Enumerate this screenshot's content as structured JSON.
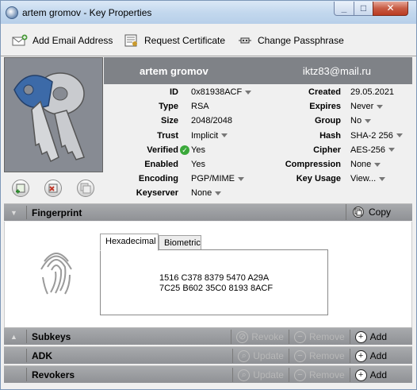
{
  "window": {
    "title": "artem gromov - Key Properties"
  },
  "toolbar": {
    "add_email": "Add Email Address",
    "request_cert": "Request Certificate",
    "change_pass": "Change Passphrase"
  },
  "header": {
    "name": "artem gromov",
    "email": "iktz83@mail.ru"
  },
  "props_left": [
    {
      "label": "ID",
      "value": "0x81938ACF",
      "dropdown": true
    },
    {
      "label": "Type",
      "value": "RSA",
      "dropdown": false
    },
    {
      "label": "Size",
      "value": "2048/2048",
      "dropdown": false
    },
    {
      "label": "Trust",
      "value": "Implicit",
      "dropdown": true
    },
    {
      "label": "Verified",
      "value": "Yes",
      "dropdown": false
    },
    {
      "label": "Enabled",
      "value": "Yes",
      "dropdown": false
    },
    {
      "label": "Encoding",
      "value": "PGP/MIME",
      "dropdown": true
    },
    {
      "label": "Keyserver",
      "value": "None",
      "dropdown": true
    }
  ],
  "props_right": [
    {
      "label": "Created",
      "value": "29.05.2021",
      "dropdown": false
    },
    {
      "label": "Expires",
      "value": "Never",
      "dropdown": true
    },
    {
      "label": "Group",
      "value": "No",
      "dropdown": true
    },
    {
      "label": "Hash",
      "value": "SHA-2 256",
      "dropdown": true
    },
    {
      "label": "Cipher",
      "value": "AES-256",
      "dropdown": true
    },
    {
      "label": "Compression",
      "value": "None",
      "dropdown": true
    },
    {
      "label": "Key Usage",
      "value": "View...",
      "dropdown": true
    }
  ],
  "fingerprint": {
    "title": "Fingerprint",
    "copy_label": "Copy",
    "tabs": [
      "Hexadecimal",
      "Biometric"
    ],
    "lines": [
      "1516 C378 8379 5470 A29A",
      "7C25 B602 35C0 8193 8ACF"
    ]
  },
  "sections": [
    {
      "title": "Subkeys",
      "actions": [
        {
          "label": "Revoke",
          "enabled": false,
          "glyph": "⊘"
        },
        {
          "label": "Remove",
          "enabled": false,
          "glyph": "−"
        },
        {
          "label": "Add",
          "enabled": true,
          "glyph": "+"
        }
      ]
    },
    {
      "title": "ADK",
      "actions": [
        {
          "label": "Update",
          "enabled": false,
          "glyph": "⌕"
        },
        {
          "label": "Remove",
          "enabled": false,
          "glyph": "−"
        },
        {
          "label": "Add",
          "enabled": true,
          "glyph": "+"
        }
      ]
    },
    {
      "title": "Revokers",
      "actions": [
        {
          "label": "Update",
          "enabled": false,
          "glyph": "⌕"
        },
        {
          "label": "Remove",
          "enabled": false,
          "glyph": "−"
        },
        {
          "label": "Add",
          "enabled": true,
          "glyph": "+"
        }
      ]
    }
  ],
  "colors": {
    "verified_green": "#3aa83a",
    "header_bg": "#7f8287",
    "bar_bg": "#9a9c9f"
  }
}
